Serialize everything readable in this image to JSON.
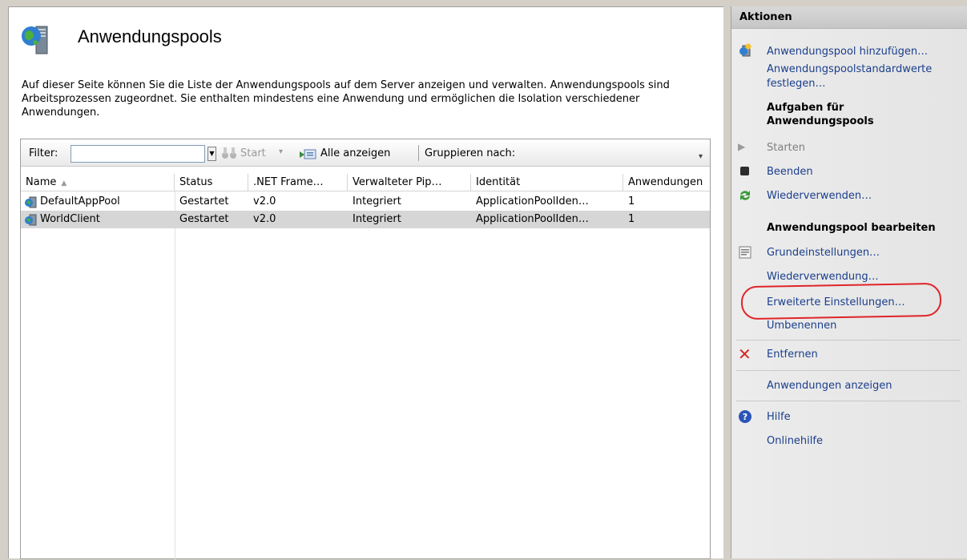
{
  "page": {
    "title": "Anwendungspools",
    "description": "Auf dieser Seite können Sie die Liste der Anwendungspools auf dem Server anzeigen und verwalten. Anwendungspools sind Arbeitsprozessen zugeordnet. Sie enthalten mindestens eine Anwendung und ermöglichen die Isolation verschiedener Anwendungen."
  },
  "toolbar": {
    "filter_label": "Filter:",
    "filter_value": "",
    "start_label": "Start",
    "show_all_label": "Alle anzeigen",
    "group_by_label": "Gruppieren nach:"
  },
  "table": {
    "columns": [
      "Name",
      "Status",
      ".NET Frame…",
      "Verwalteter Pip…",
      "Identität",
      "Anwendungen"
    ],
    "rows": [
      {
        "name": "DefaultAppPool",
        "status": "Gestartet",
        "net": "v2.0",
        "pipeline": "Integriert",
        "identity": "ApplicationPoolIden…",
        "apps": "1",
        "selected": false
      },
      {
        "name": "WorldClient",
        "status": "Gestartet",
        "net": "v2.0",
        "pipeline": "Integriert",
        "identity": "ApplicationPoolIden…",
        "apps": "1",
        "selected": true
      }
    ]
  },
  "actions": {
    "header": "Aktionen",
    "add_pool": "Anwendungspool hinzufügen…",
    "set_defaults_1": "Anwendungspoolstandardwerte",
    "set_defaults_2": "festlegen…",
    "tasks_header_1": "Aufgaben für",
    "tasks_header_2": "Anwendungspools",
    "start": "Starten",
    "stop": "Beenden",
    "recycle": "Wiederverwenden…",
    "edit_header": "Anwendungspool bearbeiten",
    "basic_settings": "Grundeinstellungen…",
    "recycling": "Wiederverwendung…",
    "advanced_settings": "Erweiterte Einstellungen…",
    "rename": "Umbenennen",
    "remove": "Entfernen",
    "view_apps": "Anwendungen anzeigen",
    "help": "Hilfe",
    "online_help": "Onlinehilfe"
  },
  "colors": {
    "link": "#1a3e8c",
    "highlight_ring": "#e0242a",
    "selected_row": "#d6d6d6"
  }
}
